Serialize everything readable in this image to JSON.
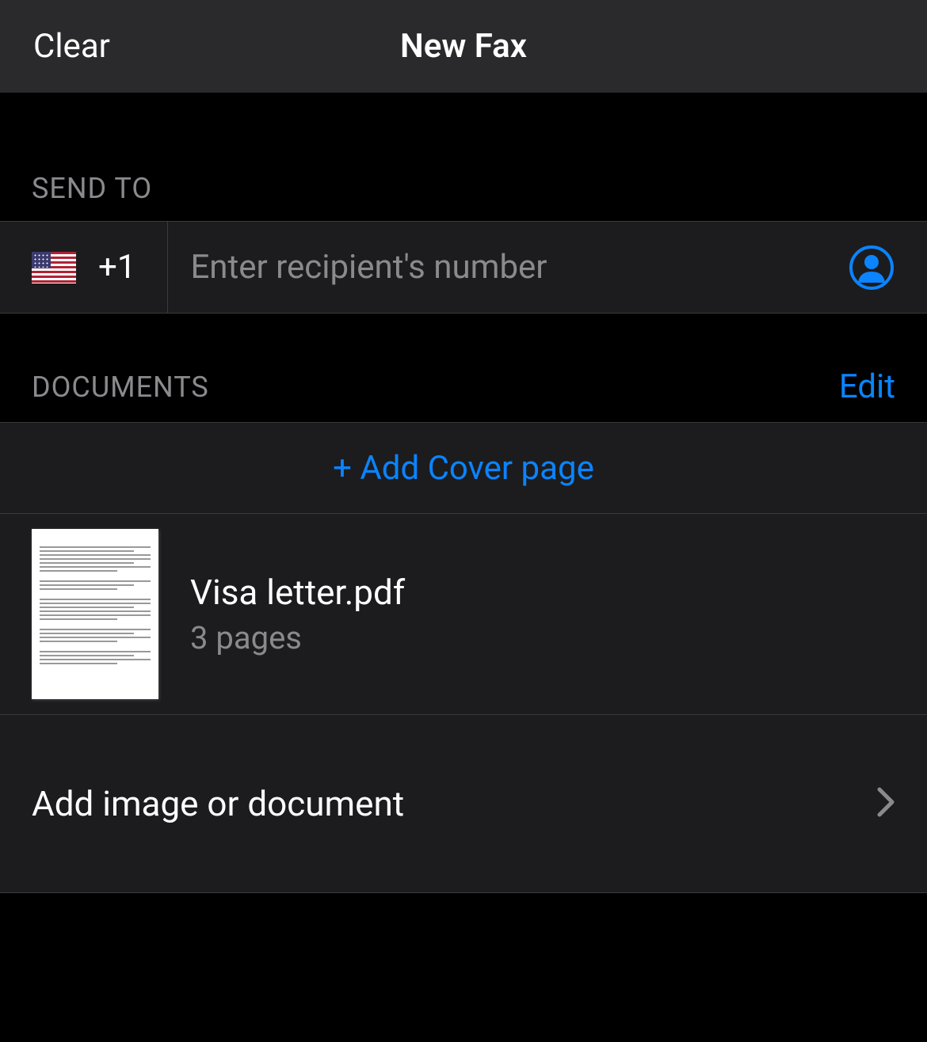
{
  "header": {
    "clear_label": "Clear",
    "title": "New Fax"
  },
  "send_to": {
    "section_label": "SEND TO",
    "dial_code": "+1",
    "flag_name": "us-flag",
    "placeholder": "Enter recipient's number",
    "value": ""
  },
  "documents": {
    "section_label": "DOCUMENTS",
    "edit_label": "Edit",
    "add_cover_label": "+ Add Cover page",
    "items": [
      {
        "name": "Visa letter.pdf",
        "pages_label": "3 pages"
      }
    ],
    "add_doc_label": "Add image or document"
  },
  "colors": {
    "accent": "#0a84ff",
    "background": "#000000",
    "row_background": "#1c1c1e",
    "header_background": "#2a2a2c",
    "secondary_text": "#8a8a8e"
  }
}
